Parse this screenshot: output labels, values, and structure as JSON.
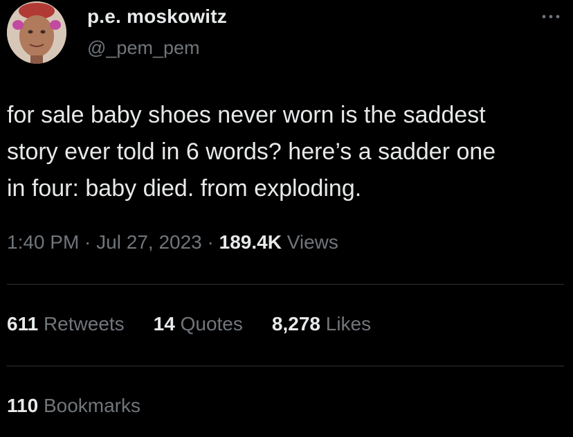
{
  "author": {
    "display_name": "p.e. moskowitz",
    "handle": "@_pem_pem",
    "avatar_icon": "profile-photo"
  },
  "more_icon": "more-options-icon",
  "tweet": {
    "text": "for sale baby shoes never worn is the saddest\nstory ever told in 6 words? here’s a sadder one\nin four: baby died. from exploding."
  },
  "meta": {
    "time": "1:40 PM",
    "separator1": " · ",
    "date": "Jul 27, 2023",
    "separator2": " · ",
    "views_count": "189.4K",
    "views_label": " Views"
  },
  "stats": {
    "retweets": {
      "count": "611",
      "label": " Retweets"
    },
    "quotes": {
      "count": "14",
      "label": " Quotes"
    },
    "likes": {
      "count": "8,278",
      "label": " Likes"
    },
    "bookmarks": {
      "count": "110",
      "label": " Bookmarks"
    }
  },
  "colors": {
    "background": "#000000",
    "primary_text": "#e7e9ea",
    "secondary_text": "#71767b",
    "divider": "#2f3336"
  }
}
